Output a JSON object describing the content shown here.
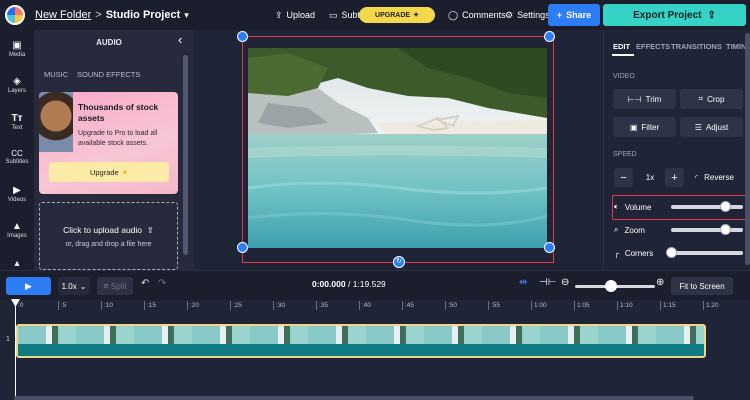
{
  "topbar": {
    "folder_link": "New Folder",
    "separator": ">",
    "project_title": "Studio Project",
    "upload_label": "Upload",
    "subtitles_label": "Subtitles",
    "upgrade_label": "UPGRADE",
    "comments_label": "Comments",
    "settings_label": "Settings",
    "share_label": "Share",
    "export_label": "Export Project"
  },
  "leftnav": [
    {
      "label": "Media",
      "icon": "media-icon"
    },
    {
      "label": "Layers",
      "icon": "layers-icon"
    },
    {
      "label": "Text",
      "icon": "text-icon"
    },
    {
      "label": "Subtitles",
      "icon": "subtitles-icon"
    },
    {
      "label": "Videos",
      "icon": "videos-icon"
    },
    {
      "label": "Images",
      "icon": "images-icon"
    }
  ],
  "audio_panel": {
    "title": "AUDIO",
    "tabs": [
      "MUSIC",
      "SOUND EFFECTS"
    ],
    "promo": {
      "title": "Thousands of stock assets",
      "body": "Upgrade to Pro to load all available stock assets.",
      "button": "Upgrade"
    },
    "upload": {
      "title": "Click to upload audio",
      "subtitle": "or, drag and drop a file here"
    }
  },
  "right_panel": {
    "tabs": [
      "EDIT",
      "EFFECTS",
      "TRANSITIONS",
      "TIMING"
    ],
    "video_section": "VIDEO",
    "buttons": {
      "trim": "Trim",
      "crop": "Crop",
      "filter": "Filter",
      "adjust": "Adjust"
    },
    "speed_section": "SPEED",
    "speed_value": "1x",
    "reverse_label": "Reverse",
    "volume_label": "Volume",
    "zoom_label": "Zoom",
    "corners_label": "Corners",
    "volume_level": 0.75,
    "zoom_level": 0.75,
    "corners_level": 0.0
  },
  "timeline": {
    "rate": "1.0x",
    "split_label": "Split",
    "current_time": "0:00.000",
    "time_separator": "/",
    "total_time": "1:19.529",
    "fit_label": "Fit to Screen",
    "track_number": "1",
    "ruler": [
      ":0",
      ":5",
      ":10",
      ":15",
      ":20",
      ":25",
      ":30",
      ":35",
      ":40",
      ":45",
      ":50",
      ":55",
      "1:00",
      "1:05",
      "1:10",
      "1:15",
      "1:20"
    ]
  },
  "colors": {
    "accent": "#2d7df6",
    "export": "#34d3c6",
    "selection": "#e03a48",
    "upgrade": "#f3d84c"
  }
}
